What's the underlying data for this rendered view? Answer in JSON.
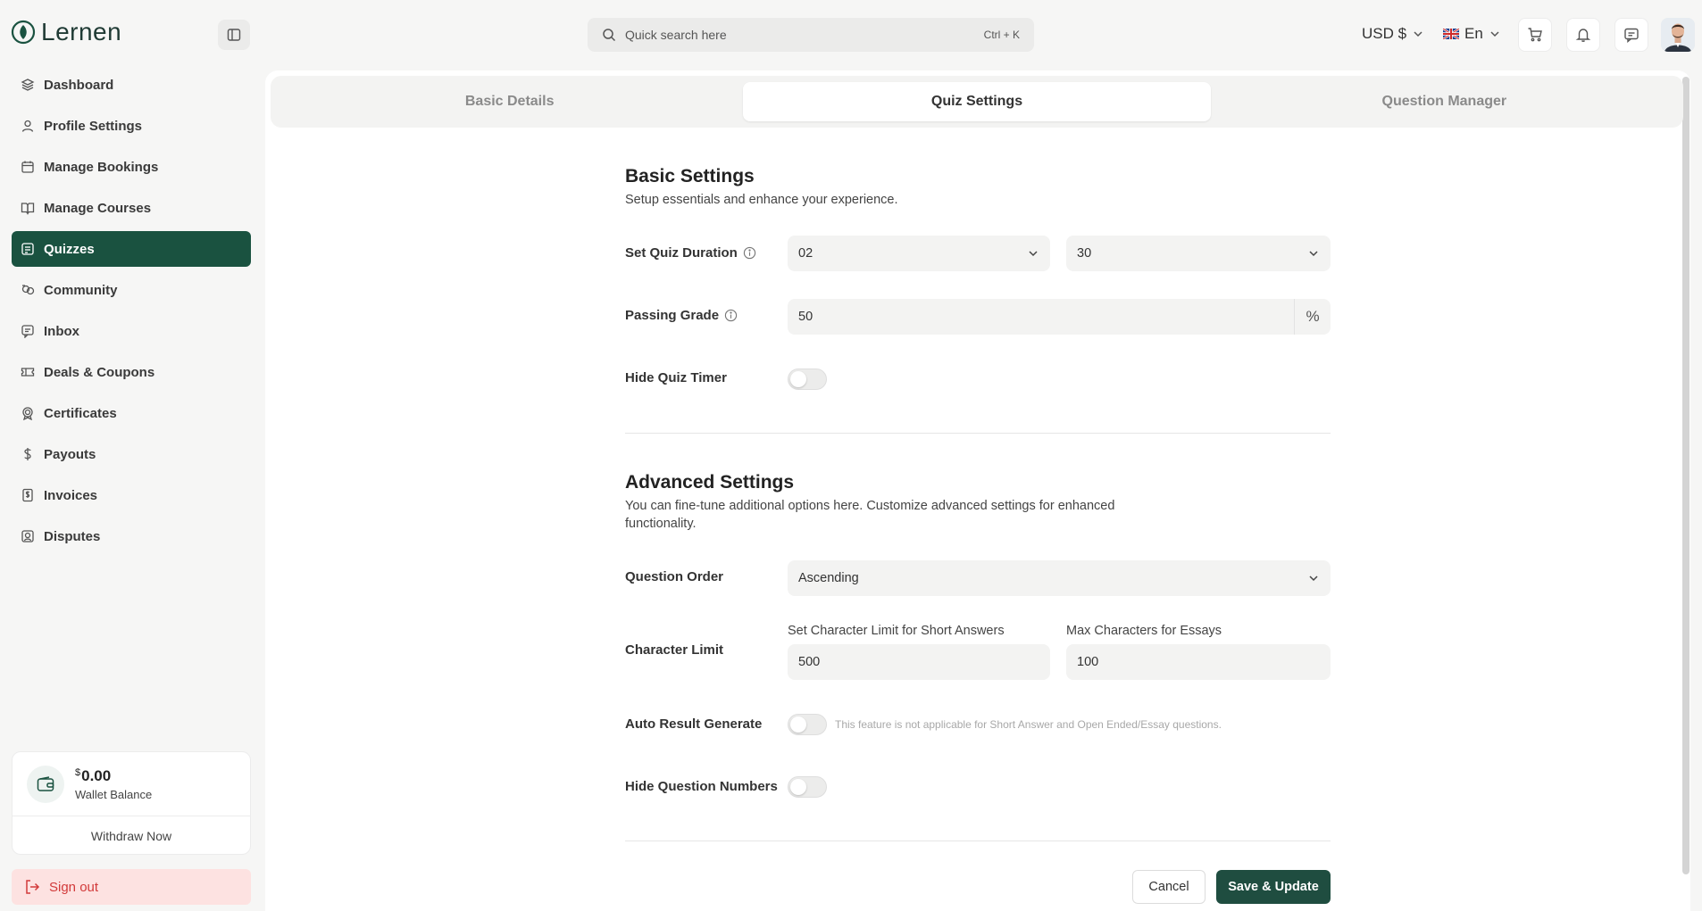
{
  "app": {
    "name": "Lernen"
  },
  "sidebar": {
    "items": [
      {
        "label": "Dashboard",
        "icon": "layers-icon"
      },
      {
        "label": "Profile Settings",
        "icon": "user-icon"
      },
      {
        "label": "Manage Bookings",
        "icon": "calendar-icon"
      },
      {
        "label": "Manage Courses",
        "icon": "book-icon"
      },
      {
        "label": "Quizzes",
        "icon": "quiz-icon",
        "active": true
      },
      {
        "label": "Community",
        "icon": "community-icon"
      },
      {
        "label": "Inbox",
        "icon": "chat-icon"
      },
      {
        "label": "Deals & Coupons",
        "icon": "ticket-icon"
      },
      {
        "label": "Certificates",
        "icon": "certificate-icon"
      },
      {
        "label": "Payouts",
        "icon": "dollar-icon"
      },
      {
        "label": "Invoices",
        "icon": "invoice-icon"
      },
      {
        "label": "Disputes",
        "icon": "dispute-icon"
      }
    ],
    "wallet": {
      "currency_symbol": "$",
      "amount": "0.00",
      "label": "Wallet Balance",
      "withdraw_label": "Withdraw Now"
    },
    "signout_label": "Sign out"
  },
  "header": {
    "search": {
      "placeholder": "Quick search here",
      "shortcut": "Ctrl + K"
    },
    "currency": "USD $",
    "language": "En"
  },
  "tabs": [
    {
      "label": "Basic Details"
    },
    {
      "label": "Quiz Settings",
      "active": true
    },
    {
      "label": "Question Manager"
    }
  ],
  "basic_settings": {
    "title": "Basic Settings",
    "subtitle": "Setup essentials and enhance your experience.",
    "quiz_duration": {
      "label": "Set Quiz Duration",
      "hours": "02",
      "minutes": "30"
    },
    "passing_grade": {
      "label": "Passing Grade",
      "value": "50",
      "suffix": "%"
    },
    "hide_quiz_timer": {
      "label": "Hide Quiz Timer",
      "on": false
    }
  },
  "advanced_settings": {
    "title": "Advanced Settings",
    "subtitle": "You can fine-tune additional options here. Customize advanced settings for enhanced functionality.",
    "question_order": {
      "label": "Question Order",
      "value": "Ascending"
    },
    "character_limit": {
      "label": "Character Limit",
      "short_label": "Set Character Limit for Short Answers",
      "short_value": "500",
      "essay_label": "Max Characters for Essays",
      "essay_value": "100"
    },
    "auto_result": {
      "label": "Auto Result Generate",
      "on": false,
      "hint": "This feature is not applicable for Short Answer and Open Ended/Essay questions."
    },
    "hide_question_numbers": {
      "label": "Hide Question Numbers",
      "on": false
    }
  },
  "actions": {
    "cancel": "Cancel",
    "save": "Save & Update"
  },
  "colors": {
    "brand": "#1a5240",
    "save_button": "#1f4d40",
    "signout_bg": "#fde2e1",
    "signout_text": "#d23a3a"
  }
}
